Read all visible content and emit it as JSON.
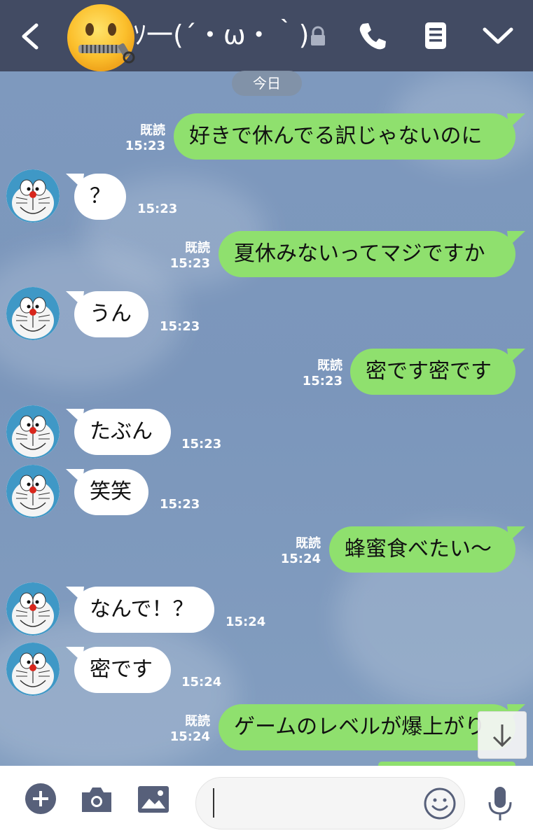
{
  "header": {
    "title": "ｿ一(´・ω・｀)",
    "back_icon": "chevron-left-icon",
    "lock_icon": "lock-icon",
    "phone_icon": "phone-icon",
    "note_icon": "note-icon",
    "menu_icon": "chevron-down-icon",
    "bg_color": "#424b63"
  },
  "date_label": "今日",
  "messages": [
    {
      "side": "out",
      "text": "好きで休んでる訳じゃないのに",
      "read": "既読",
      "time": "15:23"
    },
    {
      "side": "in",
      "text": "？",
      "time": "15:23"
    },
    {
      "side": "out",
      "text": "夏休みないってマジですか",
      "read": "既読",
      "time": "15:23"
    },
    {
      "side": "in",
      "text": "うん",
      "time": "15:23"
    },
    {
      "side": "out",
      "text": "密です密です",
      "read": "既読",
      "time": "15:23"
    },
    {
      "side": "in",
      "text": "たぶん",
      "time": "15:23"
    },
    {
      "side": "in",
      "text": "笑笑",
      "time": "15:23"
    },
    {
      "side": "out",
      "text": "蜂蜜食べたい〜",
      "read": "既読",
      "time": "15:24"
    },
    {
      "side": "in",
      "text": "なんで！？",
      "time": "15:24"
    },
    {
      "side": "in",
      "text": "密です",
      "time": "15:24"
    },
    {
      "side": "out",
      "text": "ゲームのレベルが爆上がり",
      "read": "既読",
      "time": "15:24"
    }
  ],
  "colors": {
    "outgoing_bubble": "#8fe06e",
    "incoming_bubble": "#ffffff",
    "chat_bg": "#7d98bd"
  },
  "footer": {
    "plus_icon": "plus-circle-icon",
    "camera_icon": "camera-icon",
    "image_icon": "image-icon",
    "emoji_icon": "smile-icon",
    "mic_icon": "microphone-icon",
    "message_value": ""
  },
  "scroll_down_icon": "arrow-down-icon"
}
